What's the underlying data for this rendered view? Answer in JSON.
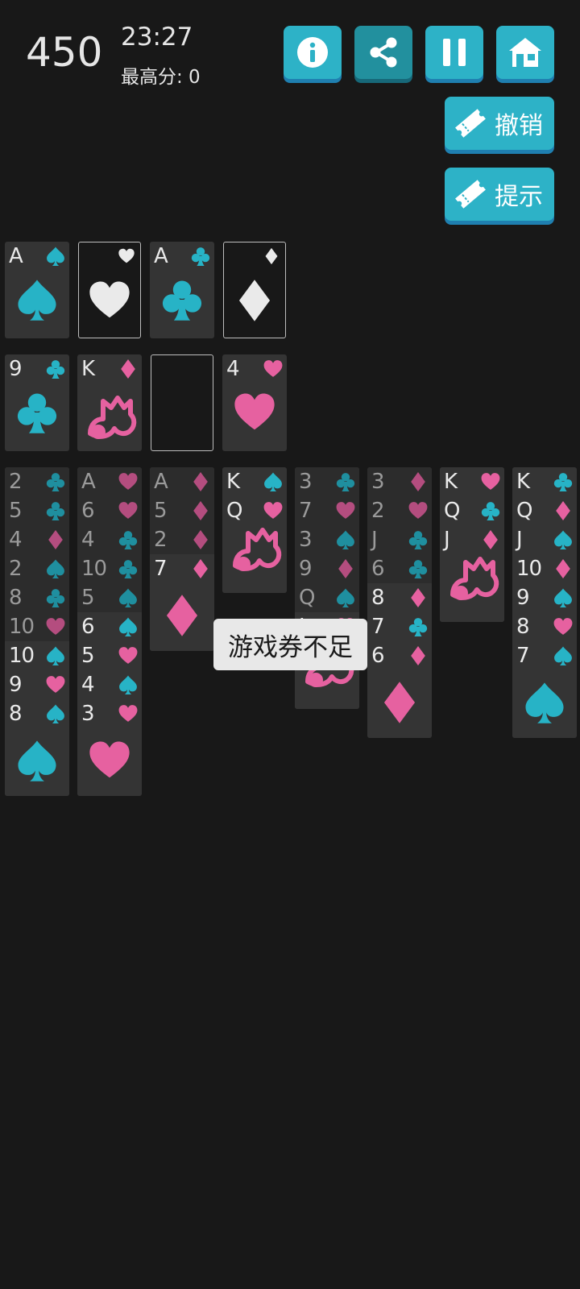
{
  "header": {
    "score": "450",
    "time": "23:27",
    "best_score": "最高分:  0"
  },
  "buttons": {
    "info": "info-icon",
    "share": "share-icon",
    "pause": "pause-icon",
    "home": "home-icon",
    "undo_label": "撤销",
    "hint_label": "提示"
  },
  "colors": {
    "accent": "#2db2c7",
    "accent_shadow": "#1f7fb0",
    "black_suit": "#27b3c6",
    "red_suit": "#e661a0",
    "dim_black_suit": "#1f8f9f",
    "dim_red_suit": "#b44d7f",
    "background": "#181818",
    "card": "#343434"
  },
  "foundations": [
    {
      "rank": "A",
      "suit": "spade"
    },
    {
      "rank": "",
      "suit": "heart"
    },
    {
      "rank": "A",
      "suit": "club"
    },
    {
      "rank": "",
      "suit": "diamond"
    }
  ],
  "reserve": [
    {
      "rank": "9",
      "suit": "club"
    },
    {
      "rank": "K",
      "suit": "diamond"
    },
    {
      "rank": "",
      "suit": ""
    },
    {
      "rank": "4",
      "suit": "heart"
    }
  ],
  "tableau": [
    [
      {
        "rank": "2",
        "suit": "club",
        "dim": true
      },
      {
        "rank": "5",
        "suit": "club",
        "dim": true
      },
      {
        "rank": "4",
        "suit": "diamond",
        "dim": true
      },
      {
        "rank": "2",
        "suit": "spade",
        "dim": true
      },
      {
        "rank": "8",
        "suit": "club",
        "dim": true
      },
      {
        "rank": "10",
        "suit": "heart",
        "dim": true
      },
      {
        "rank": "10",
        "suit": "spade"
      },
      {
        "rank": "9",
        "suit": "heart"
      },
      {
        "rank": "8",
        "suit": "spade"
      }
    ],
    [
      {
        "rank": "A",
        "suit": "heart",
        "dim": true
      },
      {
        "rank": "6",
        "suit": "heart",
        "dim": true
      },
      {
        "rank": "4",
        "suit": "club",
        "dim": true
      },
      {
        "rank": "10",
        "suit": "club",
        "dim": true
      },
      {
        "rank": "5",
        "suit": "spade",
        "dim": true
      },
      {
        "rank": "6",
        "suit": "spade"
      },
      {
        "rank": "5",
        "suit": "heart"
      },
      {
        "rank": "4",
        "suit": "spade"
      },
      {
        "rank": "3",
        "suit": "heart"
      }
    ],
    [
      {
        "rank": "A",
        "suit": "diamond",
        "dim": true
      },
      {
        "rank": "5",
        "suit": "diamond",
        "dim": true
      },
      {
        "rank": "2",
        "suit": "diamond",
        "dim": true
      },
      {
        "rank": "7",
        "suit": "diamond"
      }
    ],
    [
      {
        "rank": "K",
        "suit": "spade"
      },
      {
        "rank": "Q",
        "suit": "heart"
      }
    ],
    [
      {
        "rank": "3",
        "suit": "club",
        "dim": true
      },
      {
        "rank": "7",
        "suit": "heart",
        "dim": true
      },
      {
        "rank": "3",
        "suit": "spade",
        "dim": true
      },
      {
        "rank": "9",
        "suit": "diamond",
        "dim": true
      },
      {
        "rank": "Q",
        "suit": "spade",
        "dim": true
      },
      {
        "rank": "J",
        "suit": "heart"
      }
    ],
    [
      {
        "rank": "3",
        "suit": "diamond",
        "dim": true
      },
      {
        "rank": "2",
        "suit": "heart",
        "dim": true
      },
      {
        "rank": "J",
        "suit": "club",
        "dim": true
      },
      {
        "rank": "6",
        "suit": "club",
        "dim": true
      },
      {
        "rank": "8",
        "suit": "diamond"
      },
      {
        "rank": "7",
        "suit": "club"
      },
      {
        "rank": "6",
        "suit": "diamond"
      }
    ],
    [
      {
        "rank": "K",
        "suit": "heart"
      },
      {
        "rank": "Q",
        "suit": "club"
      },
      {
        "rank": "J",
        "suit": "diamond"
      }
    ],
    [
      {
        "rank": "K",
        "suit": "club"
      },
      {
        "rank": "Q",
        "suit": "diamond"
      },
      {
        "rank": "J",
        "suit": "spade"
      },
      {
        "rank": "10",
        "suit": "diamond"
      },
      {
        "rank": "9",
        "suit": "spade"
      },
      {
        "rank": "8",
        "suit": "heart"
      },
      {
        "rank": "7",
        "suit": "spade"
      }
    ]
  ],
  "toast": "游戏券不足"
}
